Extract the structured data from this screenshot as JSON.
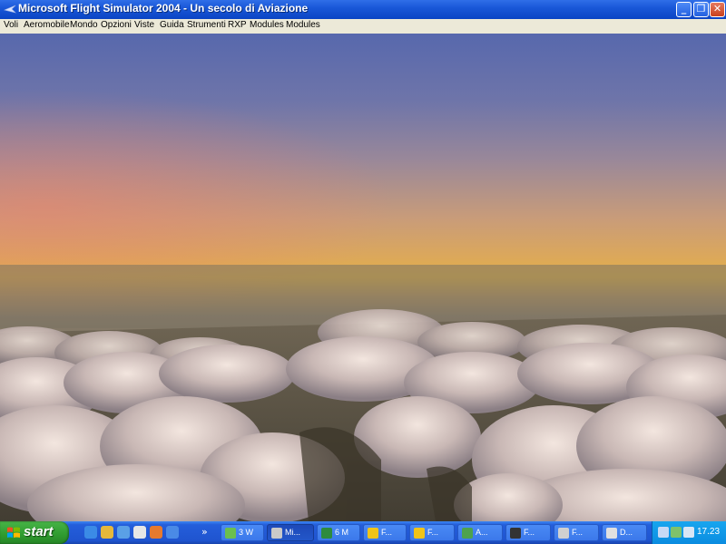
{
  "window": {
    "title": "Microsoft Flight Simulator 2004 - Un secolo di Aviazione",
    "buttons": {
      "minimize": "_",
      "maximize": "❐",
      "close": "✕"
    }
  },
  "menu": [
    {
      "label": "Voli"
    },
    {
      "label": "Aeromobile"
    },
    {
      "label": "Mondo"
    },
    {
      "label": "Opzioni"
    },
    {
      "label": "Viste"
    },
    {
      "label": "Guida"
    },
    {
      "label": "Strumenti"
    },
    {
      "label": "RXP"
    },
    {
      "label": "Modules"
    },
    {
      "label": "Modules"
    }
  ],
  "scene": {
    "description_icon": "sunset-over-clouds"
  },
  "taskbar": {
    "start_label": "start",
    "quick_launch": [
      {
        "icon": "ie-icon",
        "color": "#3b8be6"
      },
      {
        "icon": "messenger-icon",
        "color": "#e6b83b"
      },
      {
        "icon": "media-icon",
        "color": "#5aa0e6"
      },
      {
        "icon": "browser-icon",
        "color": "#e6e6e6"
      },
      {
        "icon": "firefox-icon",
        "color": "#e67a2e"
      },
      {
        "icon": "search-icon",
        "color": "#4a8ae6"
      }
    ],
    "overflow": "»",
    "tasks": [
      {
        "label": "3 W",
        "icon": "explorer-icon",
        "color": "#6bbf4e"
      },
      {
        "label": "Mi...",
        "icon": "flight-sim-icon",
        "color": "#c9c9c9",
        "active": true
      },
      {
        "label": "6 M",
        "icon": "excel-icon",
        "color": "#2e8b3e"
      },
      {
        "label": "F...",
        "icon": "folder-icon",
        "color": "#f0c419"
      },
      {
        "label": "F...",
        "icon": "folder-icon",
        "color": "#f0c419"
      },
      {
        "label": "A...",
        "icon": "aircraft-icon",
        "color": "#4ea24e"
      },
      {
        "label": "F...",
        "icon": "console-icon",
        "color": "#333333"
      },
      {
        "label": "F...",
        "icon": "plane-icon",
        "color": "#d0d0d0"
      },
      {
        "label": "D...",
        "icon": "document-icon",
        "color": "#e0e0e0"
      }
    ],
    "tray": {
      "icons": [
        {
          "icon": "network-icon",
          "color": "#c7d9f5"
        },
        {
          "icon": "users-icon",
          "color": "#7fc26b"
        },
        {
          "icon": "volume-icon",
          "color": "#d9e6f5"
        }
      ],
      "clock": "17.23"
    }
  }
}
